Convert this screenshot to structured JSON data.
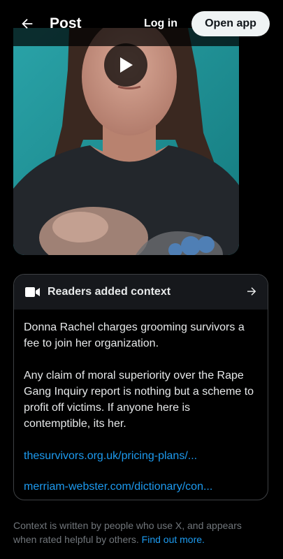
{
  "header": {
    "title": "Post",
    "back_icon": "arrow-left-icon",
    "login_label": "Log in",
    "open_app_label": "Open app"
  },
  "video": {
    "play_icon": "play-icon"
  },
  "context": {
    "title": "Readers added context",
    "header_icon": "video-camera-icon",
    "arrow_icon": "arrow-right-icon",
    "paragraph_1": "Donna Rachel charges grooming survivors a fee to join her organization.",
    "paragraph_2": "Any claim of moral superiority over the Rape Gang Inquiry report is nothing but a scheme to profit off victims. If anyone here is contemptible, its her.",
    "link_1": "thesurvivors.org.uk/pricing-plans/...",
    "link_2": "merriam-webster.com/dictionary/con..."
  },
  "footer": {
    "note": "Context is written by people who use X, and appears when rated helpful by others.",
    "find_out_more": "Find out more."
  },
  "colors": {
    "background": "#000000",
    "link": "#1d9bf0",
    "muted": "#71767b",
    "card_header": "#16181c",
    "border": "#3e4144",
    "video_wall": "#1c8c8f"
  }
}
